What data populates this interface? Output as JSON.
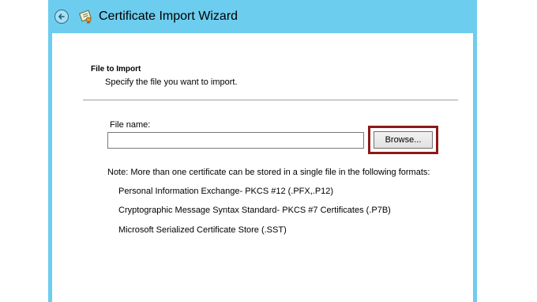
{
  "window": {
    "title": "Certificate Import Wizard",
    "accent_color": "#6dcdee",
    "back_icon": "back-arrow-icon",
    "app_icon": "certificate-icon"
  },
  "section": {
    "heading": "File to Import",
    "description": "Specify the file you want to import."
  },
  "file": {
    "label": "File name:",
    "value": "",
    "placeholder": ""
  },
  "browse_button": {
    "label": "Browse...",
    "highlight_color": "#8b1a1a"
  },
  "note": "Note:  More than one certificate can be stored in a single file in the following formats:",
  "formats": [
    "Personal Information Exchange- PKCS #12 (.PFX,.P12)",
    "Cryptographic Message Syntax Standard- PKCS #7 Certificates (.P7B)",
    "Microsoft Serialized Certificate Store (.SST)"
  ]
}
